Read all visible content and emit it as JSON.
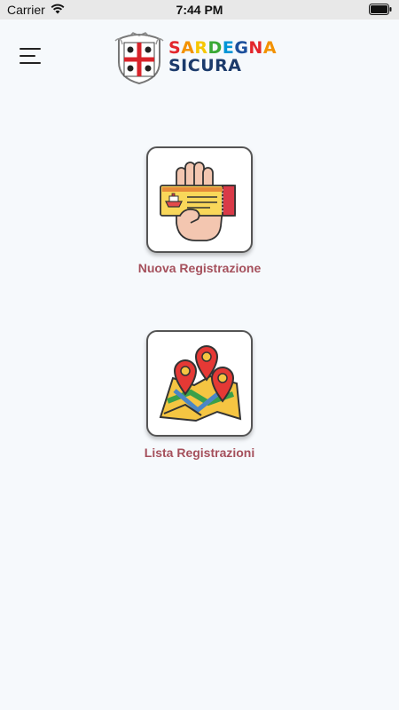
{
  "status_bar": {
    "carrier": "Carrier",
    "time": "7:44 PM"
  },
  "header": {
    "logo": {
      "line1_letters": [
        "S",
        "A",
        "R",
        "D",
        "E",
        "G",
        "N",
        "A"
      ],
      "line1_colors": [
        "#e3262c",
        "#f39200",
        "#f6c700",
        "#3aa935",
        "#0095d6",
        "#1b4f9c",
        "#e3262c",
        "#f39200"
      ],
      "line2": "SICURA",
      "line2_color": "#1b3a6b"
    }
  },
  "main": {
    "new_registration_label": "Nuova Registrazione",
    "list_registrations_label": "Lista Registrazioni",
    "label_color": "#a5505c"
  }
}
